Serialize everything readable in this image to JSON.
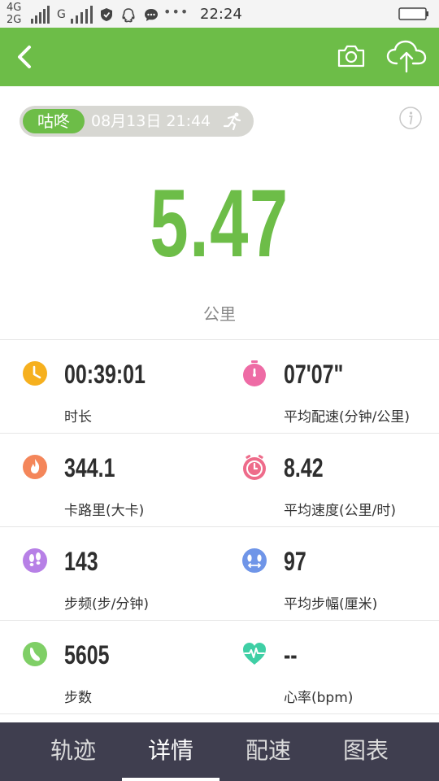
{
  "status_bar": {
    "net_top": "4G",
    "net_bottom": "2G",
    "net_g": "G",
    "dots": "•••",
    "time": "22:24"
  },
  "header": {
    "back_icon": "chevron-left-icon",
    "camera_icon": "camera-icon",
    "upload_icon": "cloud-upload-icon"
  },
  "source": {
    "app_name": "咕咚",
    "datetime": "08月13日 21:44",
    "activity_icon": "running-man-icon"
  },
  "distance": {
    "value": "5.47",
    "unit": "公里"
  },
  "stats": [
    {
      "value": "00:39:01",
      "label": "时长",
      "icon": "clock-icon",
      "color": "#f6b01e"
    },
    {
      "value": "07'07\"",
      "label": "平均配速(分钟/公里)",
      "icon": "stopwatch-icon",
      "color": "#ee6ba5"
    },
    {
      "value": "344.1",
      "label": "卡路里(大卡)",
      "icon": "flame-icon",
      "color": "#f4865a"
    },
    {
      "value": "8.42",
      "label": "平均速度(公里/时)",
      "icon": "stopwatch-icon",
      "color": "#ee6b8a"
    },
    {
      "value": "143",
      "label": "步频(步/分钟)",
      "icon": "footprints-icon",
      "color": "#b780e6"
    },
    {
      "value": "97",
      "label": "平均步幅(厘米)",
      "icon": "stride-icon",
      "color": "#6f95e8"
    },
    {
      "value": "5605",
      "label": "步数",
      "icon": "shoe-icon",
      "color": "#7fcf66"
    },
    {
      "value": "--",
      "label": "心率(bpm)",
      "icon": "heartbeat-icon",
      "color": "#3fcfa5"
    }
  ],
  "tabs": [
    {
      "label": "轨迹"
    },
    {
      "label": "详情"
    },
    {
      "label": "配速"
    },
    {
      "label": "图表"
    }
  ],
  "active_tab": "详情",
  "colors": {
    "accent": "#6dbd48",
    "tabbar": "#3f3e4f"
  }
}
